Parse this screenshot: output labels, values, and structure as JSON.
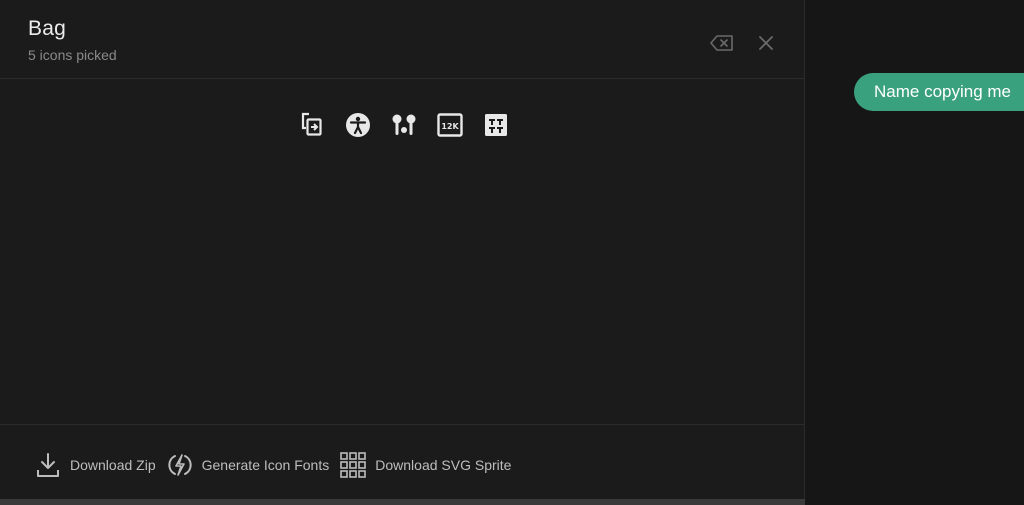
{
  "bag": {
    "title": "Bag",
    "subtitle": "5 icons picked"
  },
  "header_actions": {
    "clear_icon": "backspace-icon",
    "close_icon": "close-icon"
  },
  "picked_icons": [
    {
      "name": "tab-move-icon"
    },
    {
      "name": "accessibility-icon"
    },
    {
      "name": "earbuds-icon"
    },
    {
      "name": "resolution-12k-icon"
    },
    {
      "name": "subtitle-icon"
    }
  ],
  "footer": {
    "download_zip": "Download Zip",
    "generate_fonts": "Generate Icon Fonts",
    "download_sprite": "Download SVG Sprite"
  },
  "toast": {
    "text": "Name copying me",
    "color": "#3aa17e"
  },
  "colors": {
    "background": "#161616",
    "panel": "#1b1b1b",
    "text": "#ececec",
    "muted": "#8a8a8a"
  }
}
